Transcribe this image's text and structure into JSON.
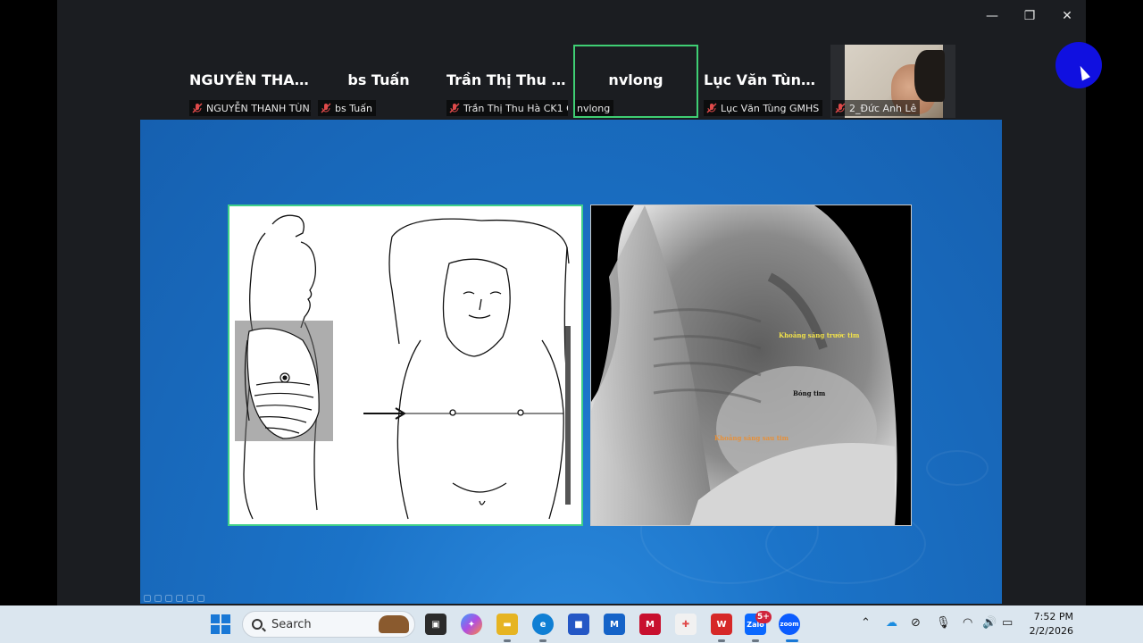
{
  "window": {
    "controls": {
      "minimize": "—",
      "restore": "❐",
      "close": "✕"
    }
  },
  "participants": [
    {
      "display_name": "NGUYỄN THAN...",
      "label": "NGUYỄN THANH TÙN...",
      "muted": true
    },
    {
      "display_name": "bs Tuấn",
      "label": "bs Tuấn",
      "muted": true
    },
    {
      "display_name": "Trần Thị Thu Hà...",
      "label": "Trần Thị Thu Hà CK1 C...",
      "muted": true
    },
    {
      "display_name": "nvlong",
      "label": "nvlong",
      "muted": false,
      "active_speaker": true
    },
    {
      "display_name": "Lục Văn Tùng G...",
      "label": "Lục Văn Tùng GMHS",
      "muted": true
    },
    {
      "display_name": "",
      "label": "2_Đức Anh Lê",
      "muted": true,
      "video_on": true
    }
  ],
  "slide": {
    "xray_labels": {
      "retrosternal": "Khoảng sáng trước tim",
      "heart": "Bóng tim",
      "retrocardiac": "Khoảng sáng sau tim"
    }
  },
  "taskbar": {
    "search_placeholder": "Search",
    "notification_badge": "5+",
    "apps": [
      {
        "name": "task-view",
        "glyph": "▣",
        "color": "#2b2b2b"
      },
      {
        "name": "copilot",
        "glyph": "✦",
        "color": "#7a4de0"
      },
      {
        "name": "file-explorer",
        "glyph": "▬",
        "color": "#e6b422"
      },
      {
        "name": "edge",
        "glyph": "e",
        "color": "#0f7fd4"
      },
      {
        "name": "store",
        "glyph": "■",
        "color": "#2457c5"
      },
      {
        "name": "mailbird",
        "glyph": "M",
        "color": "#1463c8"
      },
      {
        "name": "mcafee",
        "glyph": "M",
        "color": "#c8102e"
      },
      {
        "name": "app-red",
        "glyph": "✚",
        "color": "#e04a4a"
      },
      {
        "name": "wps-office",
        "glyph": "W",
        "color": "#d62828"
      },
      {
        "name": "zalo",
        "glyph": "Zalo",
        "color": "#0a68ff"
      },
      {
        "name": "zoom",
        "glyph": "zoom",
        "color": "#0b5cff"
      }
    ],
    "clock": {
      "time": "7:52 PM",
      "date": "2/2/2026"
    }
  }
}
